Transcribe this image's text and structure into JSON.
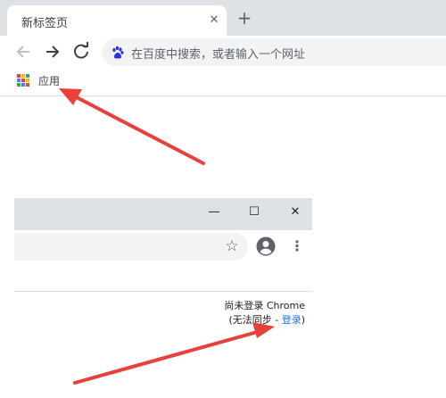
{
  "browser": {
    "tab_title": "新标签页",
    "close_glyph": "✕",
    "newtab_glyph": "+",
    "omnibox_placeholder": "在百度中搜索，或者输入一个网址",
    "bookmarks": {
      "apps_label": "应用"
    }
  },
  "icons": {
    "back": "arrow-left-icon",
    "forward": "arrow-right-icon",
    "reload": "reload-icon",
    "search_engine": "baidu-paw-icon",
    "apps": "apps-grid-icon",
    "star": "star-icon",
    "avatar": "account-circle-icon",
    "menu": "kebab-menu-icon"
  },
  "apps_grid_colors": [
    "#ea4335",
    "#fbbc04",
    "#34a853",
    "#4285f4",
    "#ea4335",
    "#fbbc04",
    "#34a853",
    "#4285f4",
    "#ea4335"
  ],
  "profile_window": {
    "minimize_glyph": "—",
    "maximize_glyph": "☐",
    "close_glyph": "✕",
    "star_glyph": "☆",
    "kebab_glyph": "⋮",
    "sync_status_line1": "尚未登录 Chrome",
    "sync_status_prefix": "(无法同步 - ",
    "sync_status_link": "登录",
    "sync_status_suffix": ")"
  },
  "colors": {
    "tabstrip": "#dee1e6",
    "omnibox": "#f1f3f4",
    "link": "#1a73e8",
    "arrow": "#e8403a"
  }
}
